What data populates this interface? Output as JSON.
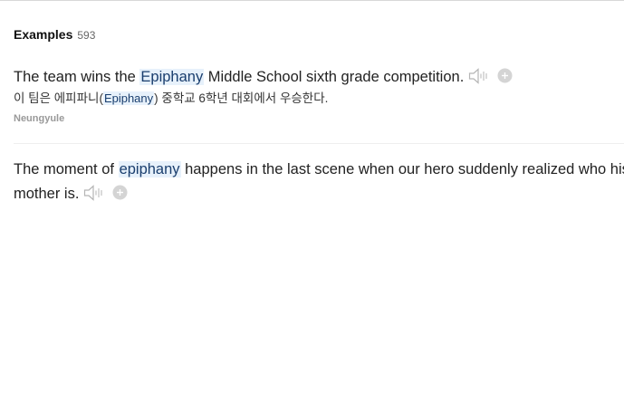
{
  "section": {
    "title": "Examples",
    "count": "593"
  },
  "examples": [
    {
      "before": "The team wins the ",
      "keyword": "Epiphany",
      "after": " Middle School sixth grade competition.",
      "translation_before": "이 팀은 에피파니(",
      "translation_keyword": "Epiphany",
      "translation_after": ") 중학교 6학년 대회에서 우승한다.",
      "source": "Neungyule"
    },
    {
      "before": "The moment of ",
      "keyword": "epiphany",
      "after": " happens in the last scene when our hero suddenly realized who his mother is."
    }
  ],
  "icons": {
    "speaker": "speaker-icon",
    "add": "plus-circle-icon"
  },
  "colors": {
    "highlight_bg": "#e7f1fb",
    "icon_gray": "#c8c8c8"
  }
}
